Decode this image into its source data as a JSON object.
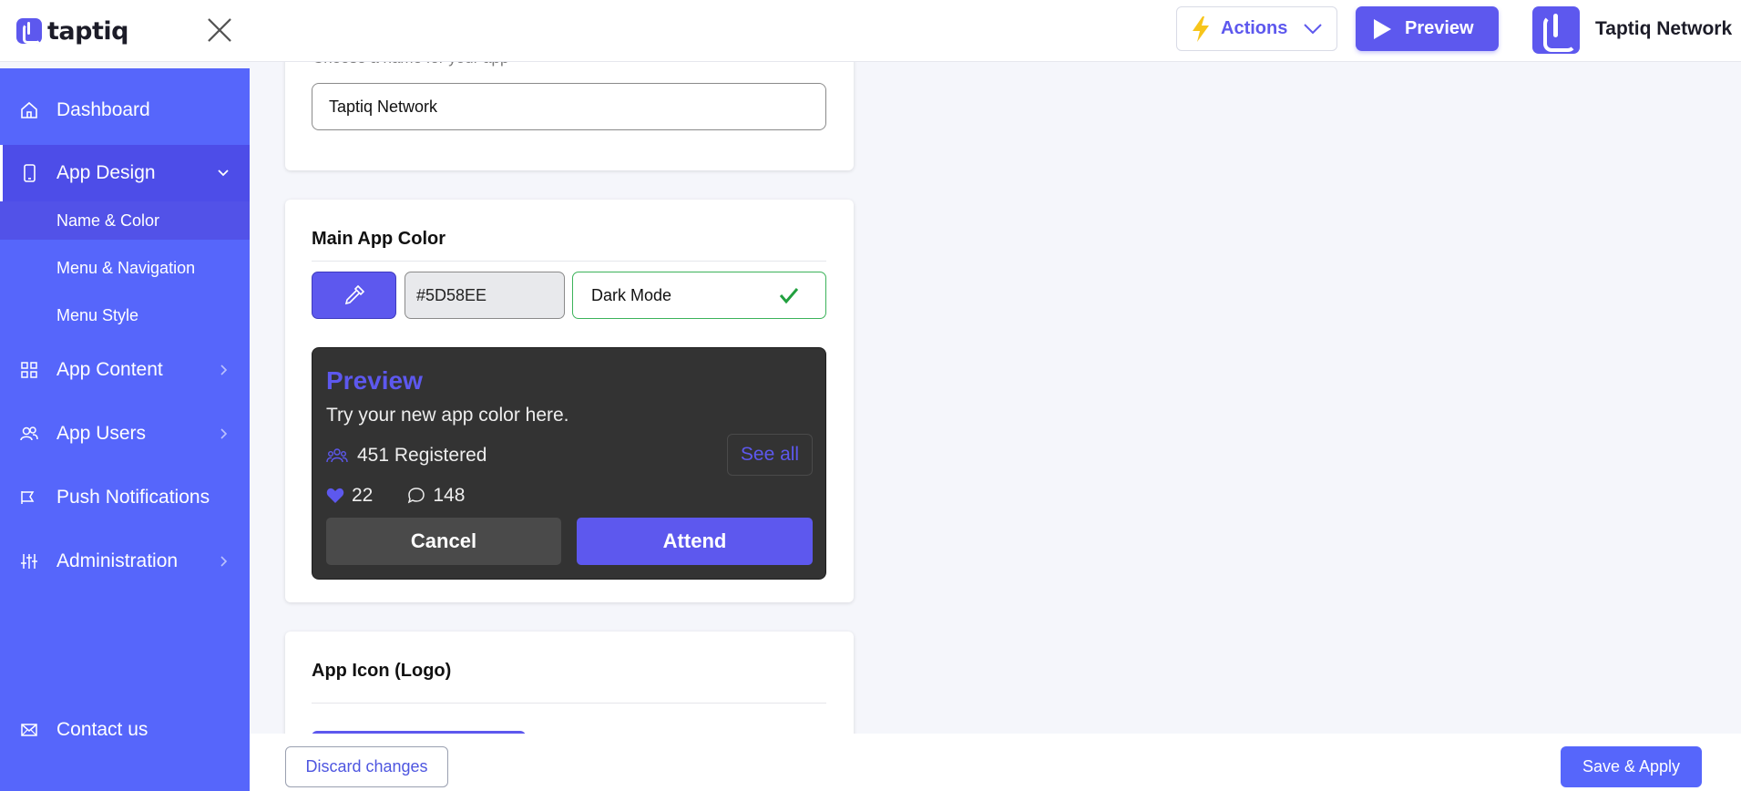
{
  "header": {
    "logo_text": "taptiq",
    "actions_label": "Actions",
    "preview_label": "Preview",
    "user_name": "Taptiq Network"
  },
  "sidebar": {
    "items": [
      {
        "label": "Dashboard",
        "icon": "home-icon"
      },
      {
        "label": "App Design",
        "icon": "phone-icon",
        "expanded": true
      },
      {
        "label": "App Content",
        "icon": "grid-icon"
      },
      {
        "label": "App Users",
        "icon": "users-icon"
      },
      {
        "label": "Push Notifications",
        "icon": "megaphone-icon"
      },
      {
        "label": "Administration",
        "icon": "sliders-icon"
      },
      {
        "label": "Contact us",
        "icon": "mail-icon"
      }
    ],
    "subitems": [
      {
        "label": "Name & Color",
        "active": true
      },
      {
        "label": "Menu & Navigation"
      },
      {
        "label": "Menu Style"
      }
    ]
  },
  "app_name": {
    "hint": "Choose a name for your app",
    "value": "Taptiq Network"
  },
  "main_color": {
    "title": "Main App Color",
    "hex_value": "#5D58EE",
    "dark_mode_label": "Dark Mode",
    "dark_mode_checked": true,
    "accent": "#5D58EE"
  },
  "preview": {
    "title": "Preview",
    "subtitle": "Try your new app color here.",
    "registered": "451 Registered",
    "see_all": "See all",
    "likes": "22",
    "comments": "148",
    "cancel": "Cancel",
    "attend": "Attend"
  },
  "app_icon": {
    "title": "App Icon (Logo)"
  },
  "footer": {
    "discard_label": "Discard changes",
    "save_label": "Save & Apply"
  }
}
